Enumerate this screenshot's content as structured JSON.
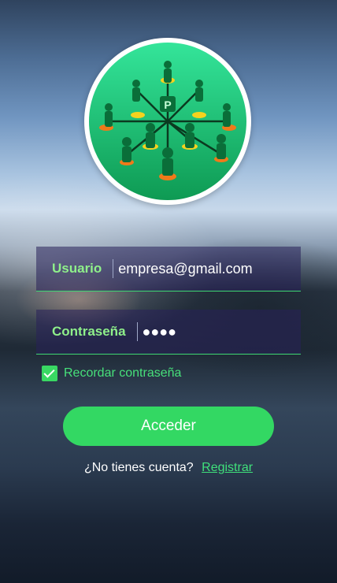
{
  "login": {
    "username_label": "Usuario",
    "username_value": "empresa@gmail.com",
    "password_label": "Contraseña",
    "password_value": "●●●●",
    "remember_label": "Recordar contraseña",
    "remember_checked": true,
    "submit_label": "Acceder",
    "no_account_text": "¿No tienes cuenta?",
    "register_link": "Registrar"
  },
  "logo": {
    "icon": "people-network-logo"
  },
  "colors": {
    "accent": "#33d863",
    "label_green": "#8ff08a",
    "field_bg": "#28205a"
  }
}
